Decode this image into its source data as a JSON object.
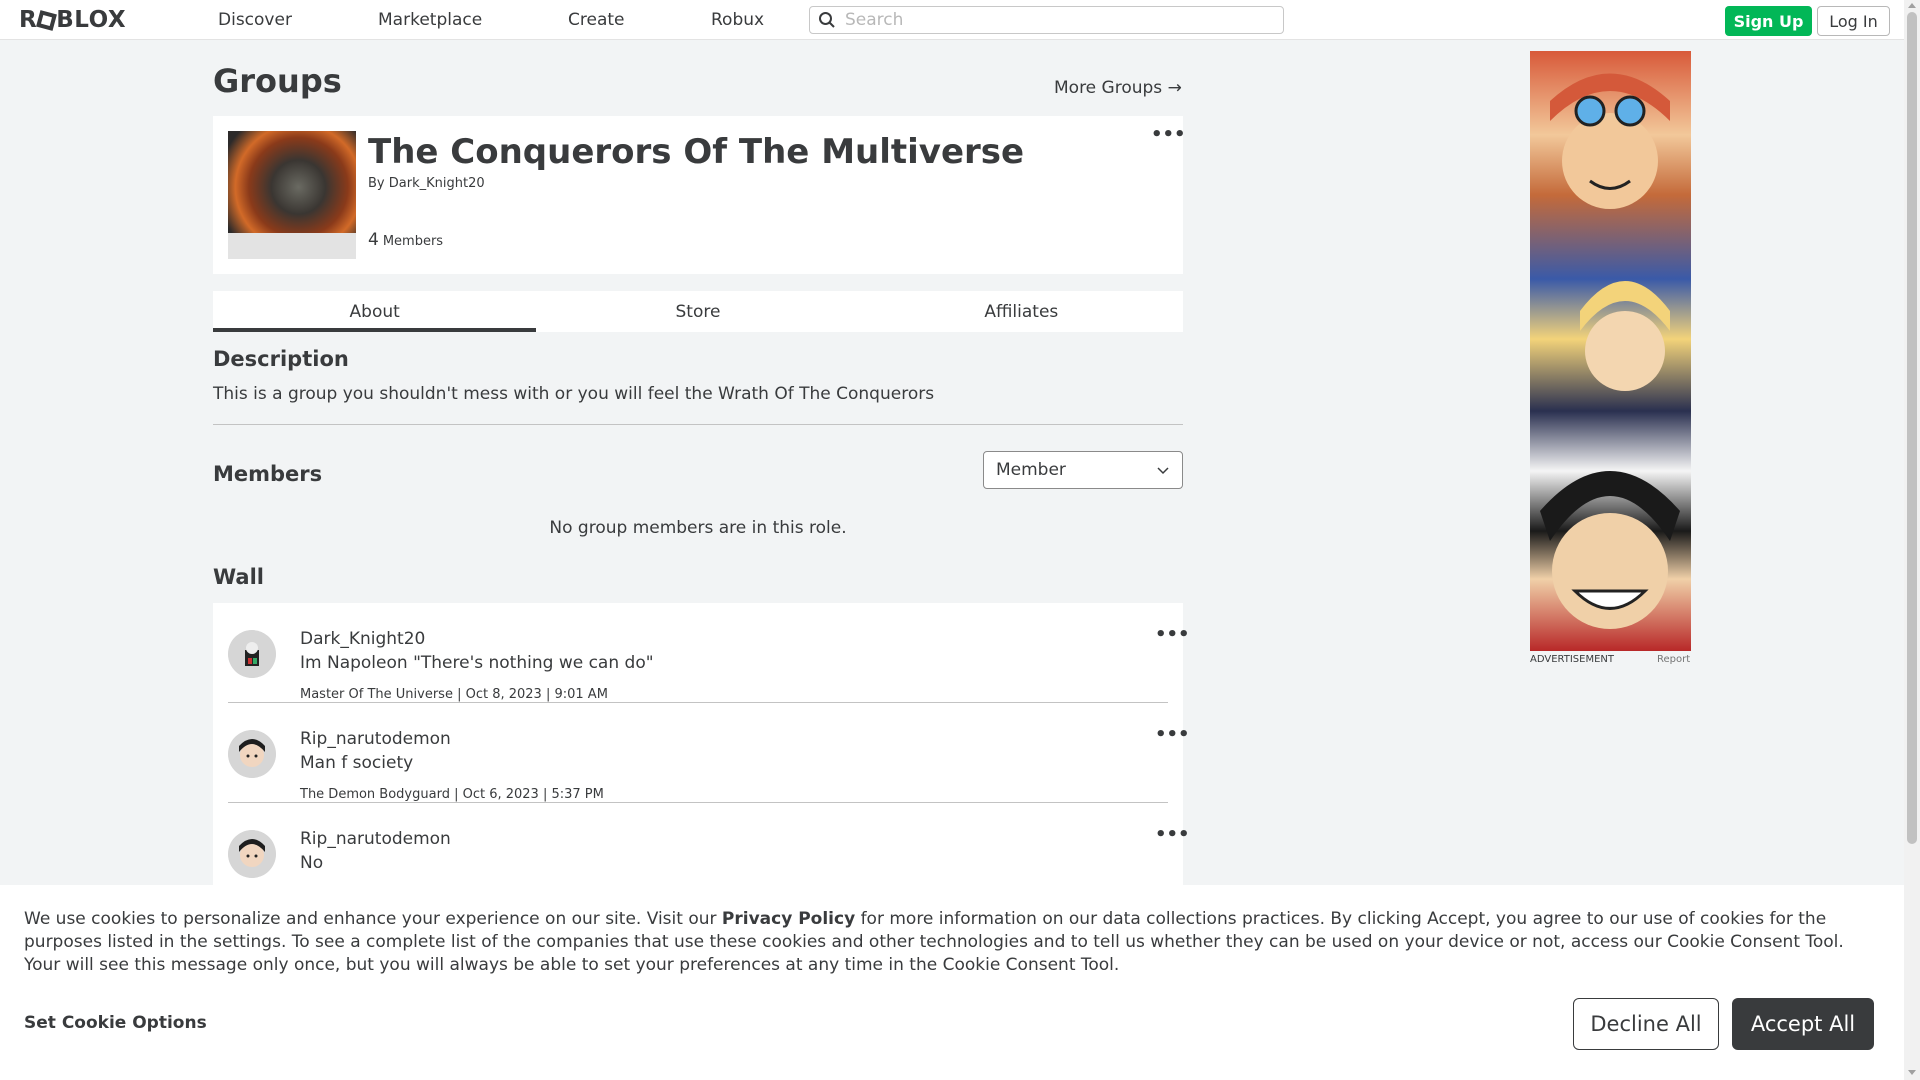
{
  "nav": {
    "logo": "ROBLOX",
    "links": [
      "Discover",
      "Marketplace",
      "Create",
      "Robux"
    ],
    "search_placeholder": "Search",
    "signup": "Sign Up",
    "login": "Log In"
  },
  "page": {
    "title": "Groups",
    "more_groups": "More Groups →"
  },
  "group": {
    "name": "The Conquerors Of The Multiverse",
    "by_label": "By",
    "owner": "Dark_Knight20",
    "member_count": "4",
    "members_label": "Members",
    "menu": "•••"
  },
  "tabs": [
    "About",
    "Store",
    "Affiliates"
  ],
  "about": {
    "description_heading": "Description",
    "description": "This is a group you shouldn't mess with or you will feel the Wrath Of The Conquerors",
    "members_heading": "Members",
    "role_selected": "Member",
    "no_members": "No group members are in this role.",
    "wall_heading": "Wall"
  },
  "wall": [
    {
      "author": "Dark_Knight20",
      "body": "Im Napoleon \"There's nothing we can do\"",
      "meta": "Master Of The Universe | Oct 8, 2023 | 9:01 AM"
    },
    {
      "author": "Rip_narutodemon",
      "body": "Man f society",
      "meta": "The Demon Bodyguard | Oct 6, 2023 | 5:37 PM"
    },
    {
      "author": "Rip_narutodemon",
      "body": "No",
      "meta": ""
    }
  ],
  "ad": {
    "label": "ADVERTISEMENT",
    "report": "Report"
  },
  "cookie": {
    "text_before": "We use cookies to personalize and enhance your experience on our site. Visit our ",
    "link": "Privacy Policy",
    "text_after": " for more information on our data collections practices. By clicking Accept, you agree to our use of cookies for the purposes listed in the settings. To see a complete list of the companies that use these cookies and other technologies and to tell us whether they can be used on your device or not, access our Cookie Consent Tool. Your will see this message only once, but you will always be able to set your preferences at any time in the Cookie Consent Tool.",
    "options": "Set Cookie Options",
    "decline": "Decline All",
    "accept": "Accept All"
  }
}
